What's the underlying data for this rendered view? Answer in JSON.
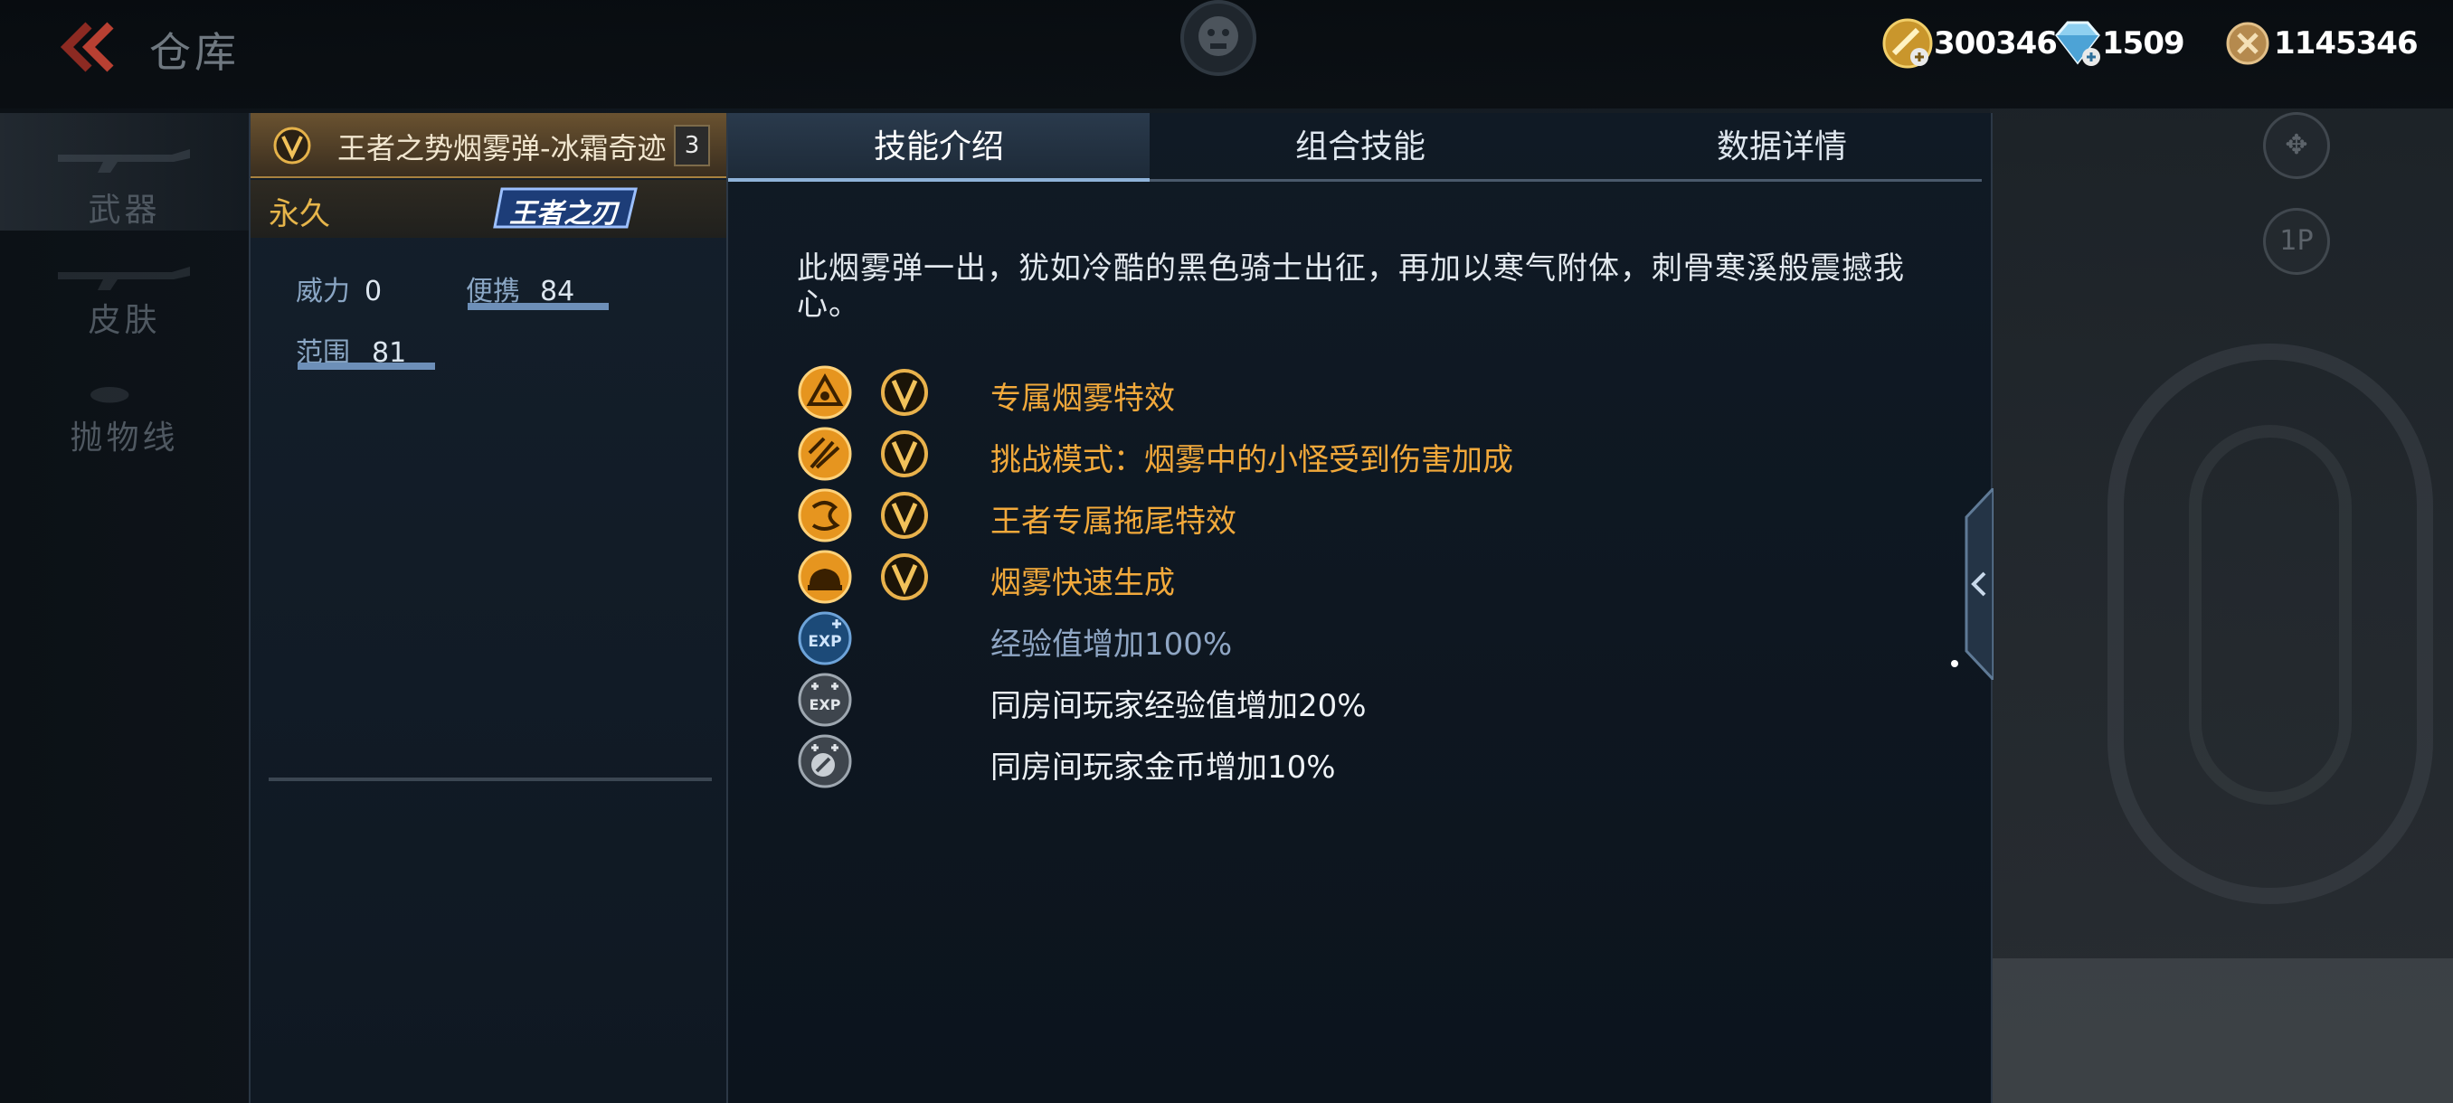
{
  "header": {
    "title": "仓库",
    "currencies": [
      {
        "icon": "gold-coin-icon",
        "amount": "300346"
      },
      {
        "icon": "diamond-icon",
        "amount": "1509"
      },
      {
        "icon": "medal-coin-icon",
        "amount": "1145346"
      }
    ]
  },
  "categories": [
    {
      "label": "武器",
      "active": true
    },
    {
      "label": "皮肤",
      "active": false
    },
    {
      "label": "抛物线",
      "active": false
    }
  ],
  "item": {
    "name": "王者之势烟雾弹-冰霜奇迹",
    "count": "3",
    "duration": "永久",
    "tag": "王者之刃",
    "stats": [
      {
        "label": "威力",
        "value": "0",
        "level": 0
      },
      {
        "label": "便携",
        "value": "84",
        "level": 0.84
      },
      {
        "label": "范围",
        "value": "81",
        "level": 0.81
      }
    ]
  },
  "tabs": [
    {
      "label": "技能介绍",
      "active": true
    },
    {
      "label": "组合技能",
      "active": false
    },
    {
      "label": "数据详情",
      "active": false
    }
  ],
  "description": "此烟雾弹一出，犹如冷酷的黑色骑士出征，再加以寒气附体，刺骨寒溪般震撼我心。",
  "skills": [
    {
      "icon": "smoke-effect-icon",
      "text": "专属烟雾特效",
      "color": "gold"
    },
    {
      "icon": "challenge-mode-icon",
      "text": "挑战模式：烟雾中的小怪受到伤害加成",
      "color": "gold"
    },
    {
      "icon": "trail-effect-icon",
      "text": "王者专属拖尾特效",
      "color": "gold"
    },
    {
      "icon": "fast-smoke-icon",
      "text": "烟雾快速生成",
      "color": "gold"
    },
    {
      "icon": "exp-boost-icon",
      "text": "经验值增加100%",
      "color": "blue"
    },
    {
      "icon": "room-exp-boost-icon",
      "text": "同房间玩家经验值增加20%",
      "color": "white"
    },
    {
      "icon": "room-gold-boost-icon",
      "text": "同房间玩家金币增加10%",
      "color": "white"
    }
  ],
  "side_buttons": [
    {
      "icon": "gamepad-icon",
      "label": ""
    },
    {
      "icon": "1p-icon",
      "label": "1P"
    }
  ],
  "colors": {
    "gold_text": "#f2a93b",
    "blue_text": "#8fa6c4",
    "stat_bar": "#6d8fb8",
    "header_gold": "#a8823f"
  }
}
